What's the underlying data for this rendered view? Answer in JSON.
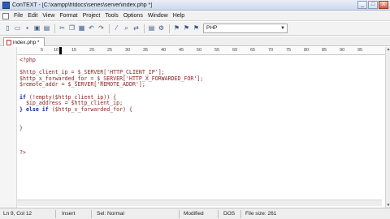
{
  "window": {
    "title": "ConTEXT - [C:\\xampp\\htdocs\\series\\server\\index.php *]",
    "minimize_label": "_",
    "maximize_label": "□",
    "close_label": "X"
  },
  "menu": {
    "items": [
      "File",
      "Edit",
      "View",
      "Format",
      "Project",
      "Tools",
      "Options",
      "Window",
      "Help"
    ]
  },
  "toolbar": {
    "buttons": [
      "new-file-icon",
      "open-icon",
      "save-icon",
      "save-all-icon",
      "print-icon",
      "cut-icon",
      "copy-icon",
      "paste-icon",
      "undo-icon",
      "redo-icon",
      "wrap-icon",
      "find-icon",
      "replace-icon",
      "export-icon",
      "tools-icon",
      "user-exec-1-icon",
      "user-exec-2-icon",
      "user-exec-3-icon"
    ],
    "syntax_selected": "PHP"
  },
  "tabs": [
    {
      "label": "index.php *"
    }
  ],
  "ruler": {
    "labels": [
      "5",
      "10",
      "15",
      "20",
      "25",
      "30",
      "35",
      "40",
      "45",
      "50",
      "55",
      "60",
      "65",
      "70",
      "75",
      "80",
      "85",
      "90",
      "95"
    ]
  },
  "editor": {
    "lines": [
      "<?php",
      "",
      "$http_client_ip = $_SERVER['HTTP_CLIENT_IP'];",
      "$http_x_forwarded_for = $_SERVER['HTTP_X_FORWARDED_FOR'];",
      "$remote_addr = $_SERVER['REMOTE_ADDR'];",
      "",
      "if (!empty($http_client_ip)) {",
      "  $ip_address = $http_client_ip;",
      "} else if ($http_x_forwarded_for) {",
      "",
      "",
      "}",
      "",
      "",
      "",
      "?>"
    ]
  },
  "status": {
    "position": "Ln 9, Col 12",
    "mode": "Insert",
    "selection": "Sel: Normal",
    "modified": "Modified",
    "format": "DOS",
    "file_size": "File size: 261"
  }
}
